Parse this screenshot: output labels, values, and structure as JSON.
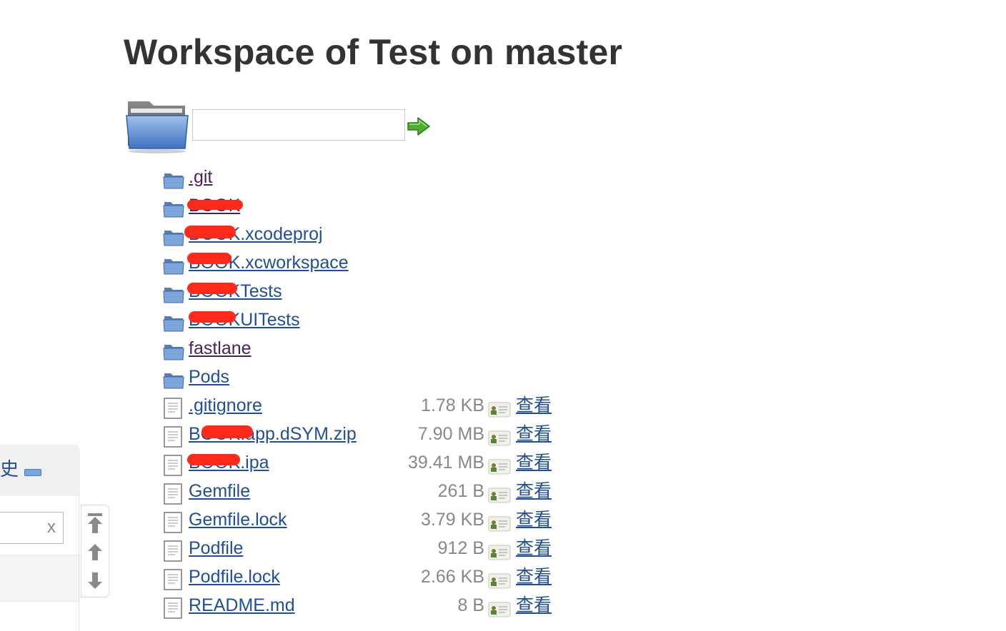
{
  "page": {
    "title": "Workspace of Test on master"
  },
  "path_bar": {
    "input_value": "",
    "go_icon": "green-arrow-right-icon"
  },
  "entries": [
    {
      "type": "folder",
      "name": ".git",
      "visited": true
    },
    {
      "type": "folder",
      "name": "BOOK",
      "visited": true
    },
    {
      "type": "folder",
      "name": "BOOK.xcodeproj"
    },
    {
      "type": "folder",
      "name": "BOOK.xcworkspace"
    },
    {
      "type": "folder",
      "name": "BOOKTests"
    },
    {
      "type": "folder",
      "name": "BOOKUITests"
    },
    {
      "type": "folder",
      "name": "fastlane",
      "visited": true
    },
    {
      "type": "folder",
      "name": "Pods"
    },
    {
      "type": "file",
      "name": ".gitignore",
      "size": "1.78 KB",
      "view": "查看"
    },
    {
      "type": "file",
      "name": "BOOK.app.dSYM.zip",
      "size": "7.90 MB",
      "view": "查看"
    },
    {
      "type": "file",
      "name": "BOOK.ipa",
      "size": "39.41 MB",
      "view": "查看"
    },
    {
      "type": "file",
      "name": "Gemfile",
      "size": "261 B",
      "view": "查看"
    },
    {
      "type": "file",
      "name": "Gemfile.lock",
      "size": "3.79 KB",
      "view": "查看"
    },
    {
      "type": "file",
      "name": "Podfile",
      "size": "912 B",
      "view": "查看"
    },
    {
      "type": "file",
      "name": "Podfile.lock",
      "size": "2.66 KB",
      "view": "查看"
    },
    {
      "type": "file",
      "name": "README.md",
      "size": "8 B",
      "view": "查看"
    }
  ],
  "left_panel": {
    "title": "史",
    "filter_value": "",
    "clear_label": "x"
  },
  "colors": {
    "link": "#1f4e9b",
    "visited": "#4a235a",
    "size_text": "#888888",
    "redaction": "#ff2a1a"
  }
}
